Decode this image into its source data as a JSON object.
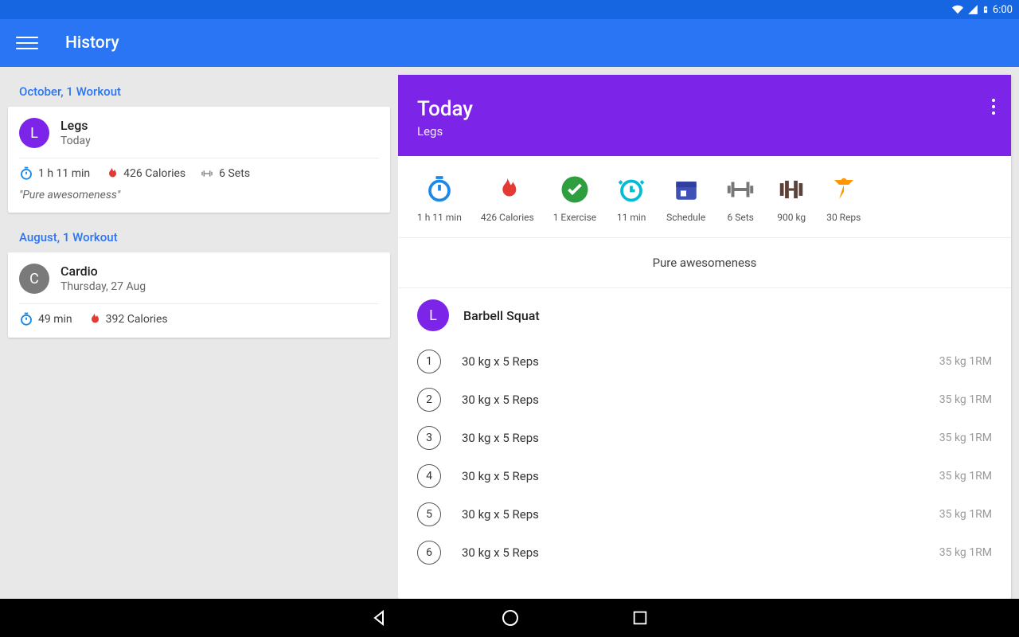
{
  "status": {
    "time": "6:00"
  },
  "toolbar": {
    "title": "History"
  },
  "sections": [
    {
      "header": "October, 1 Workout",
      "card": {
        "initial": "L",
        "title": "Legs",
        "subtitle": "Today",
        "duration": "1 h 11 min",
        "calories": "426 Calories",
        "sets": "6 Sets",
        "quote": "\"Pure awesomeness\""
      }
    },
    {
      "header": "August, 1 Workout",
      "card": {
        "initial": "C",
        "title": "Cardio",
        "subtitle": "Thursday, 27 Aug",
        "duration": "49 min",
        "calories": "392 Calories"
      }
    }
  ],
  "detail": {
    "title": "Today",
    "subtitle": "Legs",
    "metrics": {
      "duration": "1 h 11 min",
      "calories": "426 Calories",
      "exercises": "1 Exercise",
      "rest": "11 min",
      "schedule": "Schedule",
      "sets": "6 Sets",
      "weight": "900 kg",
      "reps": "30 Reps"
    },
    "note": "Pure awesomeness",
    "exercise": {
      "initial": "L",
      "name": "Barbell Squat",
      "sets": [
        {
          "n": "1",
          "text": "30 kg x 5 Reps",
          "rm": "35 kg 1RM"
        },
        {
          "n": "2",
          "text": "30 kg x 5 Reps",
          "rm": "35 kg 1RM"
        },
        {
          "n": "3",
          "text": "30 kg x 5 Reps",
          "rm": "35 kg 1RM"
        },
        {
          "n": "4",
          "text": "30 kg x 5 Reps",
          "rm": "35 kg 1RM"
        },
        {
          "n": "5",
          "text": "30 kg x 5 Reps",
          "rm": "35 kg 1RM"
        },
        {
          "n": "6",
          "text": "30 kg x 5 Reps",
          "rm": "35 kg 1RM"
        }
      ]
    }
  }
}
